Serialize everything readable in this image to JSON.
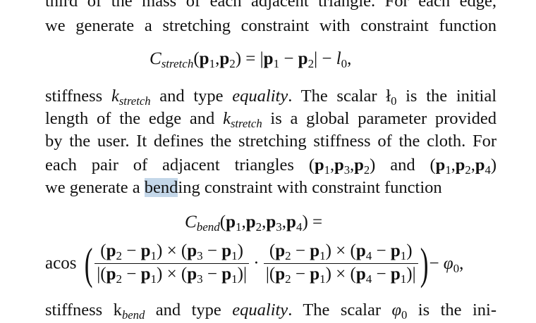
{
  "text": {
    "line1": "third of the mass of each adjacent triangle. For each edge,",
    "line2": "we generate a stretching constraint with constraint function",
    "eq1_C": "C",
    "eq1_sub": "stretch",
    "eq1_args": "(p",
    "eq1_rest": "|p",
    "eq1_l0": "l",
    "l3_a": "stiffness ",
    "l3_k": "k",
    "l3_ksub": "stretch",
    "l3_b": " and type ",
    "l3_eq": "equality",
    "l3_c": ". The scalar ł",
    "l3_d": " is the initial",
    "l4_a": "length of the edge and ",
    "l4_k": "k",
    "l4_ksub": "stretch",
    "l4_b": " is a global parameter provided",
    "l5": "by the user. It defines the stretching stiffness of the cloth. For",
    "l6_a": "each pair of adjacent triangles ",
    "l6_b": " and ",
    "l7_a": "we generate a ",
    "l7_hl": "bend",
    "l7_b": "ing constraint with constraint function",
    "eq2_C": "C",
    "eq2_sub": "bend",
    "acos": "acos",
    "phi": "φ",
    "l8": "stiffness k",
    "l8_b": " and type ",
    "l8_eq": "equality",
    "l8_c": ". The scalar ",
    "l8_d": " is the ini-"
  }
}
